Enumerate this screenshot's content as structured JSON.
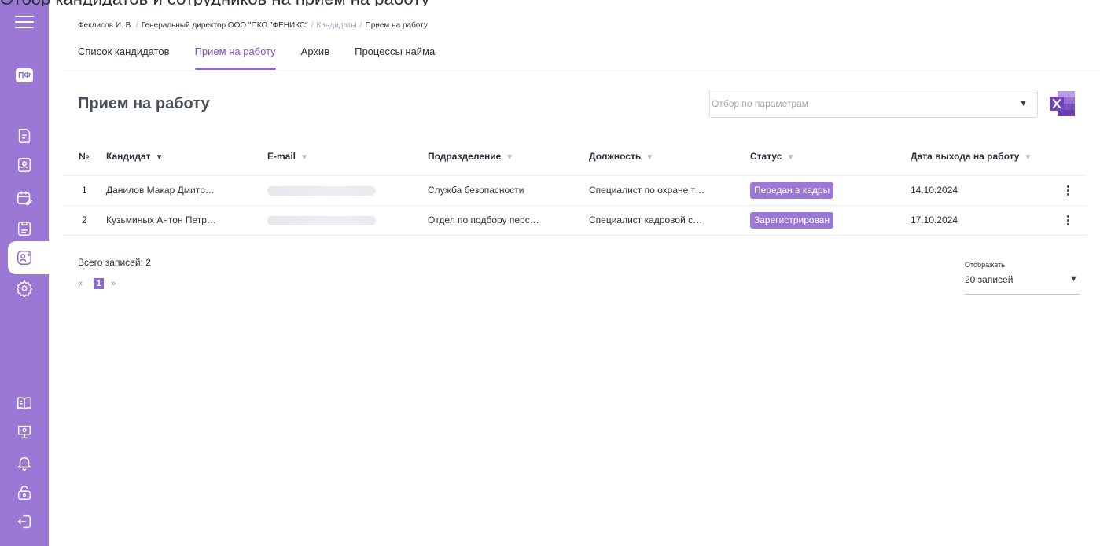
{
  "top_strip": "Отбор кандидатов и сотрудников на прием на работу",
  "sidebar": {
    "avatar_label": "ПФ",
    "icons_top": [
      "document-icon",
      "user-badge-icon",
      "calendar-edit-icon",
      "clipboard-icon",
      "user-add-icon",
      "gear-icon"
    ],
    "icons_bottom": [
      "book-icon",
      "presentation-icon",
      "bell-icon",
      "lock-open-icon",
      "logout-icon"
    ]
  },
  "breadcrumb": {
    "items": [
      "Феклисов И. В.",
      "Генеральный директор ООО \"ПКО \"ФЕНИКС\"",
      "Кандидаты",
      "Прием на работу"
    ],
    "separator": "/"
  },
  "tabs": [
    "Список кандидатов",
    "Прием на работу",
    "Архив",
    "Процессы найма"
  ],
  "page_title": "Прием на работу",
  "filter": {
    "placeholder": "Отбор по параметрам"
  },
  "table": {
    "headers": {
      "num": "№",
      "candidate": "Кандидат",
      "email": "E-mail",
      "department": "Подразделение",
      "position": "Должность",
      "status": "Статус",
      "start_date": "Дата выхода на работу"
    },
    "rows": [
      {
        "num": "1",
        "candidate": "Данилов Макар Дмитр…",
        "department": "Служба безопасности",
        "position": "Специалист по охране т…",
        "status": "Передан в кадры",
        "start_date": "14.10.2024"
      },
      {
        "num": "2",
        "candidate": "Кузьминых Антон Петр…",
        "department": "Отдел по подбору перс…",
        "position": "Специалист кадровой с…",
        "status": "Зарегистрирован",
        "start_date": "17.10.2024"
      }
    ]
  },
  "footer": {
    "total": "Всего записей: 2",
    "pager": {
      "prev": "«",
      "current": "1",
      "next": "»"
    },
    "perpage_label": "Отображать",
    "perpage_value": "20 записей"
  },
  "colors": {
    "accent": "#9b78d6",
    "accent_dark": "#7b55c7",
    "excel_green": "#1d6f42",
    "excel_purple": "#7e4fc4"
  }
}
